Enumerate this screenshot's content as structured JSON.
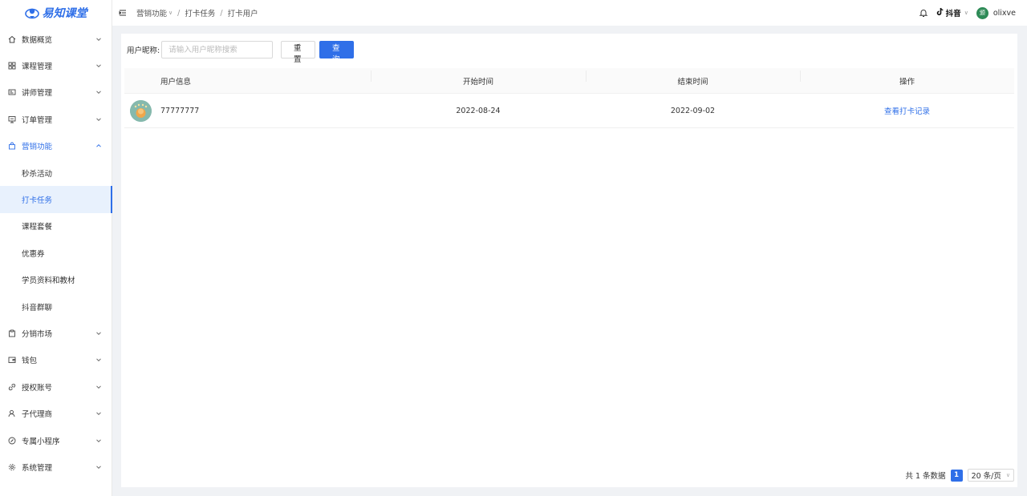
{
  "app": {
    "logo_text": "易知课堂"
  },
  "sidebar": {
    "items": [
      {
        "label": "数据概览",
        "icon": "home-icon",
        "open": false
      },
      {
        "label": "课程管理",
        "icon": "grid-icon",
        "open": false
      },
      {
        "label": "讲师管理",
        "icon": "id-card-icon",
        "open": false
      },
      {
        "label": "订单管理",
        "icon": "monitor-icon",
        "open": false
      },
      {
        "label": "营销功能",
        "icon": "shopping-bag-icon",
        "open": true
      },
      {
        "label": "分销市场",
        "icon": "clipboard-icon",
        "open": false
      },
      {
        "label": "钱包",
        "icon": "wallet-icon",
        "open": false
      },
      {
        "label": "授权账号",
        "icon": "link-icon",
        "open": false
      },
      {
        "label": "子代理商",
        "icon": "user-icon",
        "open": false
      },
      {
        "label": "专属小程序",
        "icon": "compass-icon",
        "open": false
      },
      {
        "label": "系统管理",
        "icon": "gear-icon",
        "open": false
      }
    ],
    "submenu": [
      "秒杀活动",
      "打卡任务",
      "课程套餐",
      "优惠券",
      "学员资料和教材",
      "抖音群聊"
    ],
    "active_sub": "打卡任务"
  },
  "header": {
    "breadcrumb": [
      "营销功能",
      "打卡任务",
      "打卡用户"
    ],
    "platform": "抖音",
    "user_avatar_text": "颁",
    "username": "olixve"
  },
  "filter": {
    "label": "用户昵称:",
    "placeholder": "请输入用户昵称搜索",
    "value": "",
    "reset_label": "重置",
    "query_label": "查询"
  },
  "table": {
    "columns": [
      "用户信息",
      "开始时间",
      "结束时间",
      "操作"
    ],
    "rows": [
      {
        "nickname": "77777777",
        "start": "2022-08-24",
        "end": "2022-09-02",
        "action": "查看打卡记录"
      }
    ]
  },
  "pagination": {
    "total_text": "共 1 条数据",
    "current_page": "1",
    "page_size": "20 条/页"
  },
  "colors": {
    "primary": "#2f6fe8",
    "logo": "#2f6fe8",
    "avatar": "#2e8b57"
  }
}
